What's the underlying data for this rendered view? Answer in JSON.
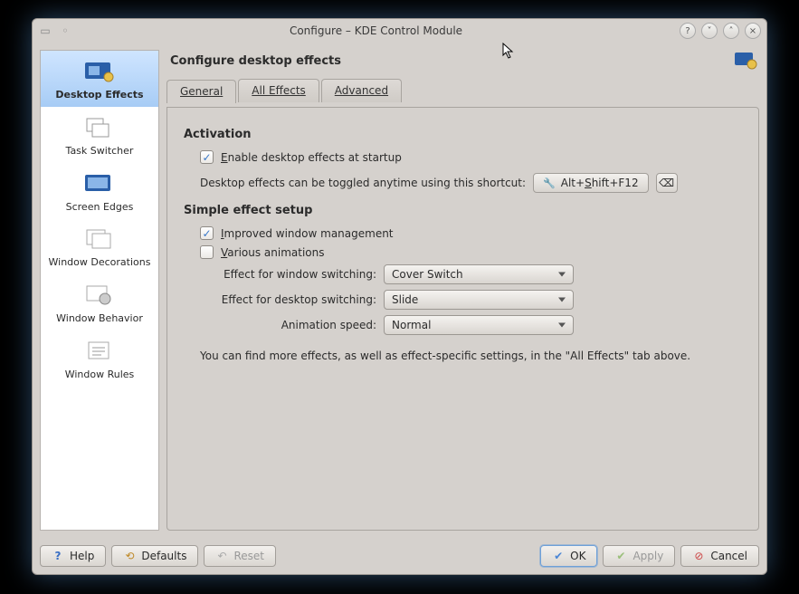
{
  "window": {
    "title": "Configure – KDE Control Module"
  },
  "sidebar": {
    "items": [
      {
        "label": "Desktop Effects"
      },
      {
        "label": "Task Switcher"
      },
      {
        "label": "Screen Edges"
      },
      {
        "label": "Window Decorations"
      },
      {
        "label": "Window Behavior"
      },
      {
        "label": "Window Rules"
      }
    ]
  },
  "header": {
    "title": "Configure desktop effects"
  },
  "tabs": {
    "general": "General",
    "all_effects": "All Effects",
    "advanced": "Advanced"
  },
  "activation": {
    "heading": "Activation",
    "enable_label_pre": "E",
    "enable_label_rest": "nable desktop effects at startup",
    "hint": "Desktop effects can be toggled anytime using this shortcut:",
    "shortcut": "Alt+Shift+F12"
  },
  "simple": {
    "heading": "Simple effect setup",
    "improved_pre": "I",
    "improved_rest": "mproved window management",
    "various_pre": "V",
    "various_rest": "arious animations",
    "win_switch_label_pre": "Effect ",
    "win_switch_label_ul": "f",
    "win_switch_label_post": "or window switching:",
    "win_switch_value": "Cover Switch",
    "desk_switch_label": "Effect for desktop switching:",
    "desk_switch_value": "Slide",
    "anim_label_pre": "A",
    "anim_label_ul": "n",
    "anim_label_post": "imation speed:",
    "anim_value": "Normal",
    "note": "You can find more effects, as well as effect-specific settings, in the \"All Effects\" tab above."
  },
  "footer": {
    "help": "Help",
    "defaults": "Defaults",
    "reset": "Reset",
    "ok": "OK",
    "apply": "Apply",
    "cancel": "Cancel"
  }
}
